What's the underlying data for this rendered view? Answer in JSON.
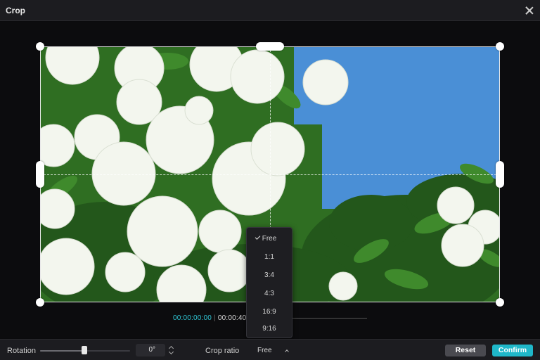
{
  "window": {
    "title": "Crop",
    "close_icon": "close-icon"
  },
  "timeline": {
    "current": "00:00:00:00",
    "separator": "|",
    "total": "00:00:40:2"
  },
  "crop_ratio_menu": {
    "options": [
      "Free",
      "1:1",
      "3:4",
      "4:3",
      "16:9",
      "9:16"
    ],
    "selected": "Free"
  },
  "bottom_bar": {
    "rotation_label": "Rotation",
    "rotation_value": "0°",
    "crop_ratio_label": "Crop ratio",
    "crop_ratio_value": "Free",
    "reset_label": "Reset",
    "confirm_label": "Confirm"
  },
  "colors": {
    "accent": "#1fb7c9",
    "timecode": "#2fc4d3",
    "sky": "#4a8fd6"
  }
}
